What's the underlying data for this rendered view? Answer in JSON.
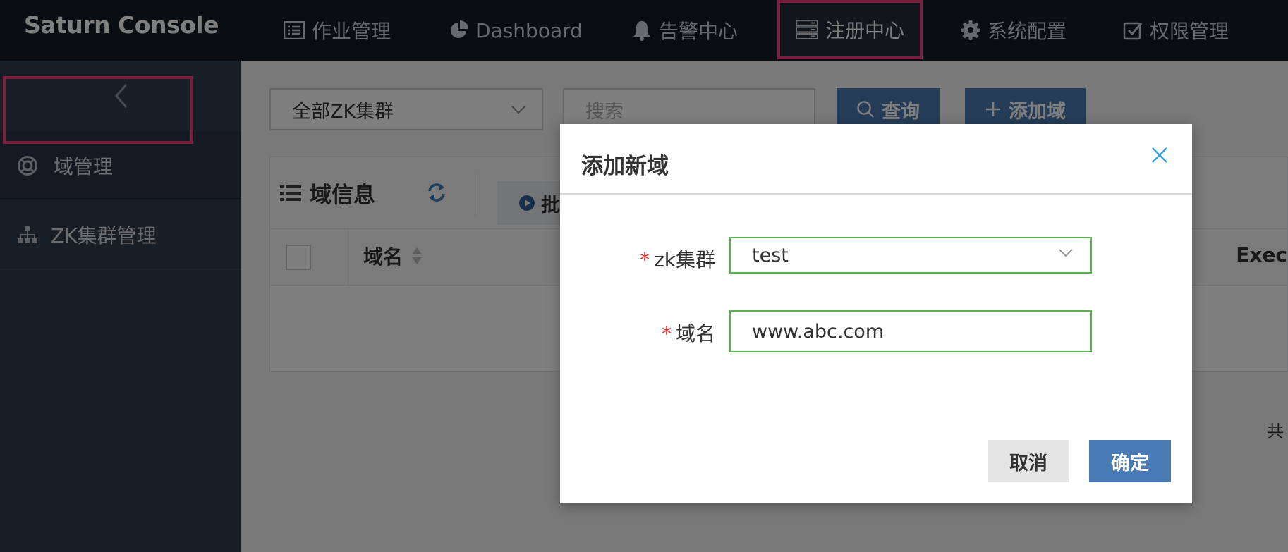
{
  "app": {
    "brand": "Saturn Console"
  },
  "topnav": {
    "items": [
      {
        "label": "作业管理",
        "icon": "list-icon"
      },
      {
        "label": "Dashboard",
        "icon": "pie-chart-icon"
      },
      {
        "label": "告警中心",
        "icon": "bell-icon"
      },
      {
        "label": "注册中心",
        "icon": "server-icon",
        "active": true
      },
      {
        "label": "系统配置",
        "icon": "gear-icon"
      },
      {
        "label": "权限管理",
        "icon": "check-square-icon"
      }
    ]
  },
  "sidebar": {
    "collapse_icon": "chevron-left-icon",
    "items": [
      {
        "label": "域管理",
        "icon": "lifebuoy-icon",
        "active": true
      },
      {
        "label": "ZK集群管理",
        "icon": "sitemap-icon"
      }
    ]
  },
  "toolbar": {
    "zk_select": "全部ZK集群",
    "search_placeholder": "搜索",
    "query_label": "查询",
    "add_label": "添加域"
  },
  "panel": {
    "title": "域信息",
    "batch_label": "批",
    "col_domain": "域名",
    "col_exec": "Exec",
    "total_prefix": "共"
  },
  "modal": {
    "title": "添加新域",
    "zk_label": "zk集群",
    "zk_value": "test",
    "domain_label": "域名",
    "domain_value": "www.abc.com",
    "required_mark": "*",
    "cancel_label": "取消",
    "ok_label": "确定"
  },
  "colors": {
    "highlight": "#f0407a",
    "primary": "#4a7ab3",
    "valid_border": "#55b34a",
    "close_icon": "#3aa0d8",
    "required": "#e02a2a"
  }
}
